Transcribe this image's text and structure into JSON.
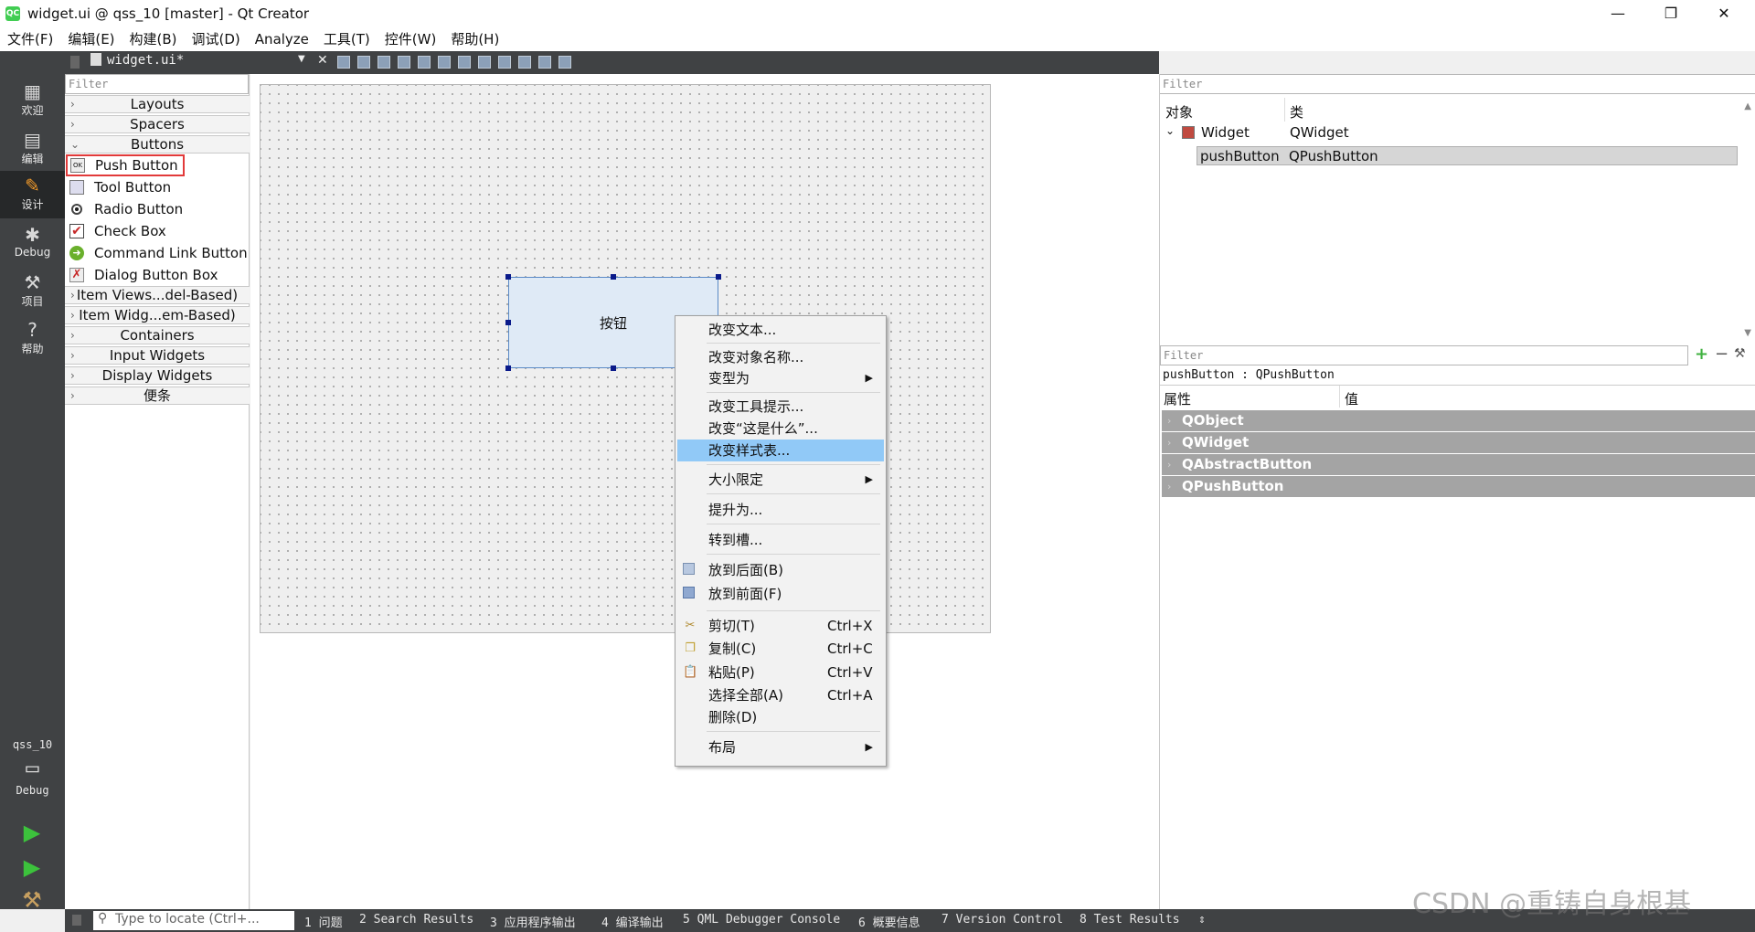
{
  "window": {
    "title": "widget.ui @ qss_10 [master] - Qt Creator",
    "app_icon": "QC"
  },
  "menubar": [
    "文件(F)",
    "编辑(E)",
    "构建(B)",
    "调试(D)",
    "Analyze",
    "工具(T)",
    "控件(W)",
    "帮助(H)"
  ],
  "modes": [
    {
      "label": "欢迎",
      "icon": "grid-icon"
    },
    {
      "label": "编辑",
      "icon": "document-icon"
    },
    {
      "label": "设计",
      "icon": "pencil-icon"
    },
    {
      "label": "Debug",
      "icon": "bug-icon"
    },
    {
      "label": "项目",
      "icon": "wrench-icon"
    },
    {
      "label": "帮助",
      "icon": "help-icon"
    }
  ],
  "kit": {
    "project": "qss_10",
    "config": "Debug"
  },
  "editor": {
    "tab_name": "widget.ui*"
  },
  "widgetbox": {
    "filter_placeholder": "Filter",
    "categories_top": [
      "Layouts",
      "Spacers",
      "Buttons"
    ],
    "buttons": [
      "Push Button",
      "Tool Button",
      "Radio Button",
      "Check Box",
      "Command Link Button",
      "Dialog Button Box"
    ],
    "categories_bottom": [
      "Item Views...del-Based)",
      "Item Widg...em-Based)",
      "Containers",
      "Input Widgets",
      "Display Widgets",
      "便条"
    ]
  },
  "form": {
    "button_text": "按钮"
  },
  "context_menu": {
    "items": [
      {
        "label": "改变文本..."
      },
      {
        "label": "改变对象名称..."
      },
      {
        "label": "变型为",
        "submenu": true
      },
      {
        "label": "改变工具提示..."
      },
      {
        "label": "改变“这是什么”..."
      },
      {
        "label": "改变样式表...",
        "highlighted": true
      },
      {
        "label": "大小限定",
        "submenu": true
      },
      {
        "label": "提升为..."
      },
      {
        "label": "转到槽..."
      },
      {
        "label": "放到后面(B)"
      },
      {
        "label": "放到前面(F)"
      },
      {
        "label": "剪切(T)",
        "shortcut": "Ctrl+X"
      },
      {
        "label": "复制(C)",
        "shortcut": "Ctrl+C"
      },
      {
        "label": "粘贴(P)",
        "shortcut": "Ctrl+V"
      },
      {
        "label": "选择全部(A)",
        "shortcut": "Ctrl+A"
      },
      {
        "label": "删除(D)"
      },
      {
        "label": "布局",
        "submenu": true
      }
    ]
  },
  "object_inspector": {
    "filter_placeholder": "Filter",
    "col_object": "对象",
    "col_class": "类",
    "rows": [
      {
        "object": "Widget",
        "class": "QWidget"
      },
      {
        "object": "pushButton",
        "class": "QPushButton"
      }
    ]
  },
  "property_editor": {
    "filter_placeholder": "Filter",
    "current": "pushButton : QPushButton",
    "col_property": "属性",
    "col_value": "值",
    "groups": [
      "QObject",
      "QWidget",
      "QAbstractButton",
      "QPushButton"
    ]
  },
  "statusbar": {
    "locator_placeholder": "Type to locate (Ctrl+...",
    "panes": [
      "1 问题",
      "2 Search Results",
      "3 应用程序输出",
      "4 编译输出",
      "5 QML Debugger Console",
      "6 概要信息",
      "7 Version Control",
      "8 Test Results"
    ]
  },
  "watermark": "CSDN @重铸自身根基"
}
